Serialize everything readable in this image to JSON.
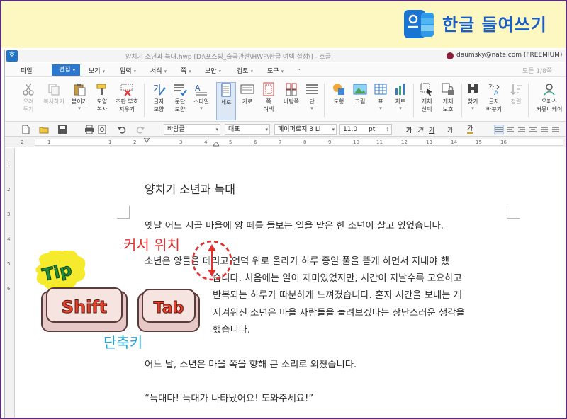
{
  "banner": {
    "title": "한글 들여쓰기",
    "logo_color": "#1a75d2",
    "background": "#fdf7c2"
  },
  "titlebar": {
    "app_icon": "호",
    "document_title": "양치기 소년과 늑대.hwp [D:\\포스팅_출국관련\\HWP\\한글 여백 설정\\] - 호글",
    "user": "daumsky@nate.com (FREEMIUM)"
  },
  "menu": {
    "items": [
      {
        "label": "파일"
      },
      {
        "label": "편집"
      },
      {
        "label": "보기"
      },
      {
        "label": "입력"
      },
      {
        "label": "서식"
      },
      {
        "label": "쪽"
      },
      {
        "label": "보안"
      },
      {
        "label": "검토"
      },
      {
        "label": "도구"
      }
    ],
    "status": "모든 1/8쪽"
  },
  "ribbon": {
    "buttons": [
      {
        "label": "오려\n두기",
        "icon": "scissors-icon"
      },
      {
        "label": "복사하기",
        "icon": "copy-icon"
      },
      {
        "label": "붙이기",
        "icon": "paste-icon"
      },
      {
        "label": "모양\n복사",
        "icon": "format-painter-icon"
      },
      {
        "label": "조판 부호\n지우기",
        "icon": "clear-format-icon"
      },
      {
        "label": "글자\n모양",
        "icon": "char-shape-icon"
      },
      {
        "label": "문단\n모양",
        "icon": "para-shape-icon"
      },
      {
        "label": "스타일",
        "icon": "style-icon"
      },
      {
        "label": "세로",
        "icon": "portrait-icon"
      },
      {
        "label": "가로",
        "icon": "landscape-icon"
      },
      {
        "label": "쪽\n여백",
        "icon": "margin-icon"
      },
      {
        "label": "바탕쪽",
        "icon": "master-page-icon"
      },
      {
        "label": "단",
        "icon": "columns-icon"
      },
      {
        "label": "도형",
        "icon": "shape-icon"
      },
      {
        "label": "그림",
        "icon": "image-icon"
      },
      {
        "label": "표",
        "icon": "table-icon"
      },
      {
        "label": "차트",
        "icon": "chart-icon"
      },
      {
        "label": "개체\n선택",
        "icon": "select-object-icon"
      },
      {
        "label": "개체\n보호",
        "icon": "protect-object-icon"
      },
      {
        "label": "찾기",
        "icon": "find-icon"
      },
      {
        "label": "글자\n바꾸기",
        "icon": "replace-icon"
      },
      {
        "label": "정렬",
        "icon": "sort-icon"
      },
      {
        "label": "오피스\n커뮤니케이",
        "icon": "office-icon"
      }
    ]
  },
  "format_toolbar": {
    "style": "바탕글",
    "font_category": "대표",
    "font": "페이퍼로지 3 Li",
    "size": "11.0",
    "unit": "pt",
    "char_buttons": [
      "가",
      "가",
      "가",
      "가",
      "가"
    ]
  },
  "ruler": {
    "h_ticks": [
      "2",
      "1",
      "",
      "1",
      "2",
      "3",
      "4",
      "5",
      "6",
      "7",
      "8",
      "9",
      "10",
      "11",
      "12",
      "13",
      "14",
      "15",
      "16"
    ],
    "v_ticks": [
      "1",
      "2",
      "3",
      "4",
      "5",
      "6"
    ]
  },
  "document": {
    "heading": "양치기 소년과 늑대",
    "para1": "옛날 어느 시골 마을에 양 떼를 돌보는 일을 맡은 한 소년이 살고 있었습니다.",
    "para2_lines": [
      "소년은 양들을 데리고 언덕 위로 올라가 하루 종일 풀을 뜯게 하면서 지내야 했",
      "습니다. 처음에는 일이 재미있었지만, 시간이 지날수록 고요하고",
      "반복되는 하루가 따분하게 느껴졌습니다. 혼자 시간을 보내는 게",
      "지겨워진 소년은 마을 사람들을 놀려보겠다는 장난스러운 생각을",
      "했습니다."
    ],
    "para3": "어느 날, 소년은 마을 쪽을 향해 큰 소리로 외쳤습니다.",
    "para4": "“늑대다! 늑대가 나타났어요! 도와주세요!”"
  },
  "annotations": {
    "cursor_label": "커서 위치",
    "shortcut_label": "단축키",
    "tip": "Tip",
    "keys": [
      "Shift",
      "Tab"
    ],
    "marker_color": "#e03131"
  }
}
